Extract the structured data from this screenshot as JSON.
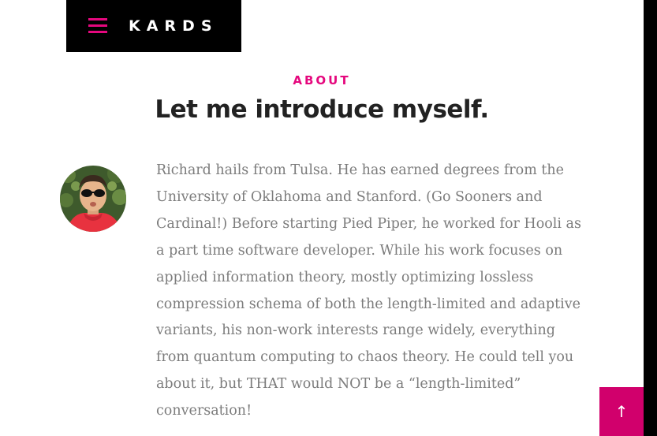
{
  "header": {
    "brand": "KARDS",
    "menu_icon": "hamburger-menu-icon",
    "accent_color": "#e5087e"
  },
  "about": {
    "section_label": "ABOUT",
    "title": "Let me introduce myself.",
    "bio": "Richard hails from Tulsa. He has earned degrees from the University of Oklahoma and Stanford. (Go Sooners and Cardinal!) Before starting Pied Piper, he worked for Hooli as a part time software developer. While his work focuses on applied information theory, mostly optimizing lossless compression schema of both the length-limited and adaptive variants, his non-work interests range widely, everything from quantum computing to chaos theory. He could tell you about it, but THAT would NOT be a “length-limited” conversation!"
  },
  "back_to_top": {
    "icon": "arrow-up-icon",
    "glyph": "↑",
    "color": "#d1006c"
  }
}
